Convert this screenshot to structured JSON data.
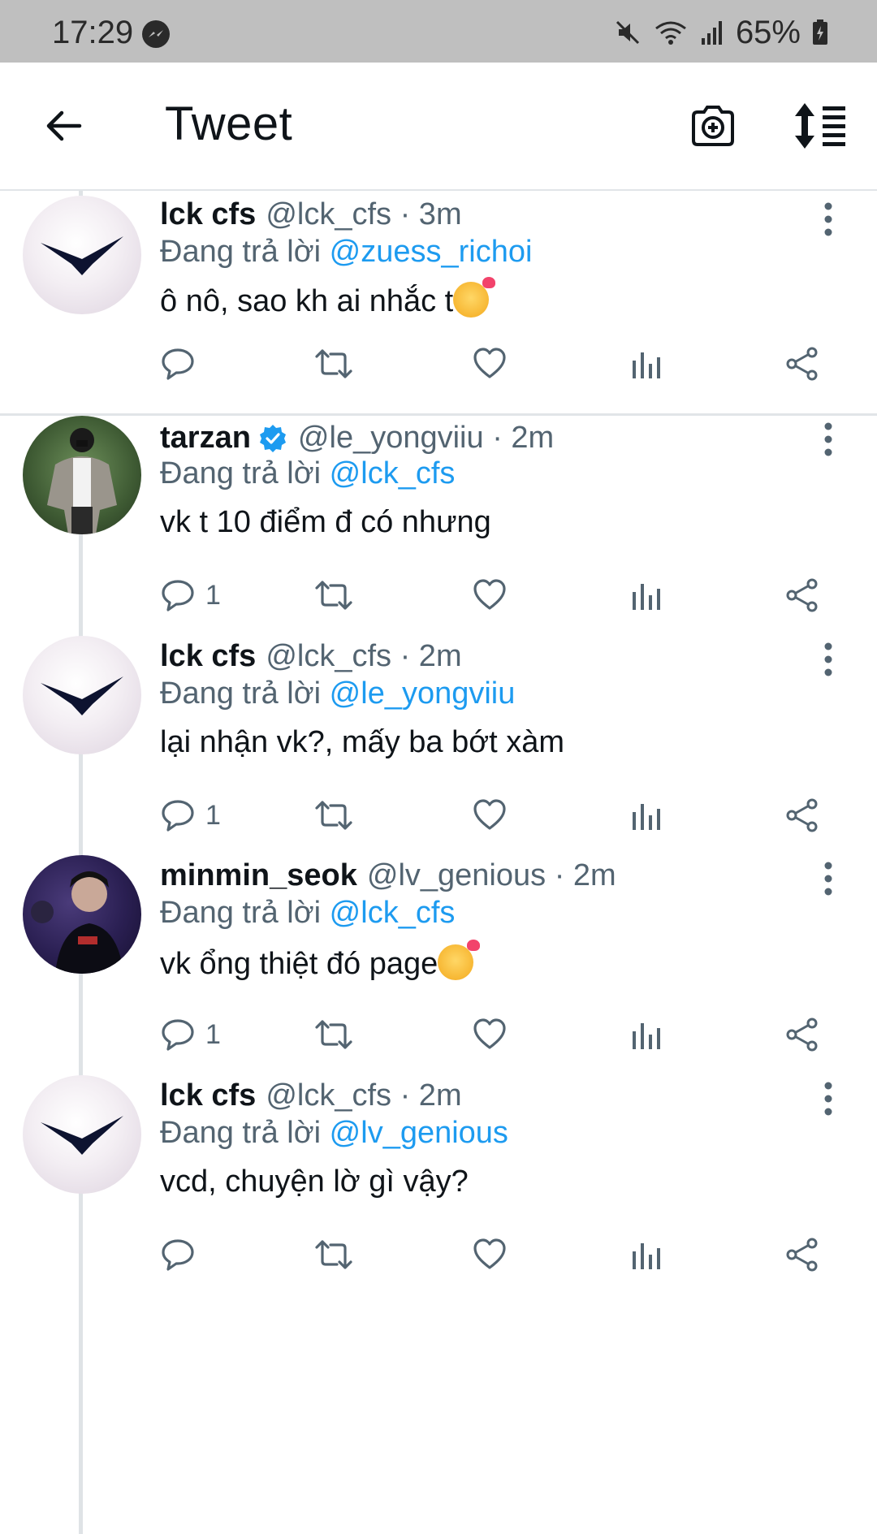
{
  "status_bar": {
    "time": "17:29",
    "battery": "65%",
    "icons": [
      "messenger-icon",
      "mute-icon",
      "wifi-icon",
      "signal-icon",
      "battery-icon"
    ]
  },
  "app_bar": {
    "title": "Tweet",
    "icons": [
      "back-arrow-icon",
      "camera-add-icon",
      "sort-icon"
    ]
  },
  "reply_prefix": "Đang trả lời",
  "colors": {
    "link": "#1d9bf0",
    "muted": "#536471",
    "text": "#0f1419",
    "verified": "#1d9bf0"
  },
  "tweets": [
    {
      "name": "lck cfs",
      "handle": "@lck_cfs",
      "time": "· 3m",
      "reply_to": "@zuess_richoi",
      "text": "ô nô, sao kh ai nhắc t",
      "emoji": "smiling-face-with-hearts",
      "verified": false,
      "reply_count": ""
    },
    {
      "name": "tarzan",
      "handle": "@le_yongviiu",
      "time": "· 2m",
      "reply_to": "@lck_cfs",
      "text": "vk t 10 điểm đ có nhưng",
      "verified": true,
      "reply_count": "1"
    },
    {
      "name": "lck cfs",
      "handle": "@lck_cfs",
      "time": "· 2m",
      "reply_to": "@le_yongviiu",
      "text": "lại nhận vk?, mấy ba bớt xàm",
      "verified": false,
      "reply_count": "1"
    },
    {
      "name": "minmin_seok",
      "handle": "@lv_genious",
      "time": "· 2m",
      "reply_to": "@lck_cfs",
      "text": "vk ổng thiệt đó page",
      "emoji": "smiling-face-with-hearts",
      "verified": false,
      "reply_count": "1"
    },
    {
      "name": "lck cfs",
      "handle": "@lck_cfs",
      "time": "· 2m",
      "reply_to": "@lv_genious",
      "text": "vcd, chuyện lờ gì vậy?",
      "verified": false,
      "reply_count": ""
    }
  ]
}
